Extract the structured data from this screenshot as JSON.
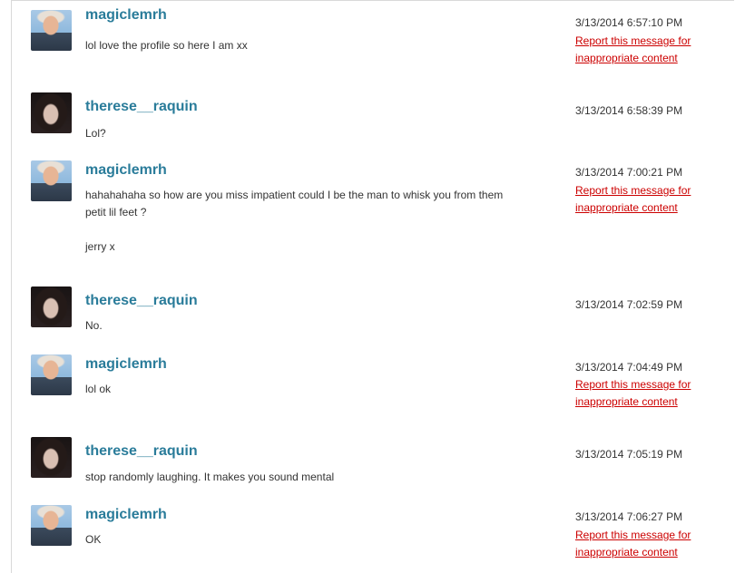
{
  "messages": [
    {
      "user": "magiclemrh",
      "text": "lol love the profile so here I am xx",
      "time": "3/13/2014 6:57:10 PM",
      "report": "Report this message for inappropriate content"
    },
    {
      "user": "therese__raquin",
      "text": "Lol?",
      "time": "3/13/2014 6:58:39 PM"
    },
    {
      "user": "magiclemrh",
      "text": "hahahahaha so how are you miss impatient could I be the man to whisk you from them petit lil feet ?",
      "text2": "jerry x",
      "time": "3/13/2014 7:00:21 PM",
      "report": "Report this message for inappropriate content"
    },
    {
      "user": "therese__raquin",
      "text": "No.",
      "time": "3/13/2014 7:02:59 PM"
    },
    {
      "user": "magiclemrh",
      "text": "lol ok",
      "time": "3/13/2014 7:04:49 PM",
      "report": "Report this message for inappropriate content"
    },
    {
      "user": "therese__raquin",
      "text": "stop randomly laughing. It makes you sound mental",
      "time": "3/13/2014 7:05:19 PM"
    },
    {
      "user": "magiclemrh",
      "text": "OK",
      "time": "3/13/2014 7:06:27 PM",
      "report": "Report this message for inappropriate content"
    }
  ]
}
